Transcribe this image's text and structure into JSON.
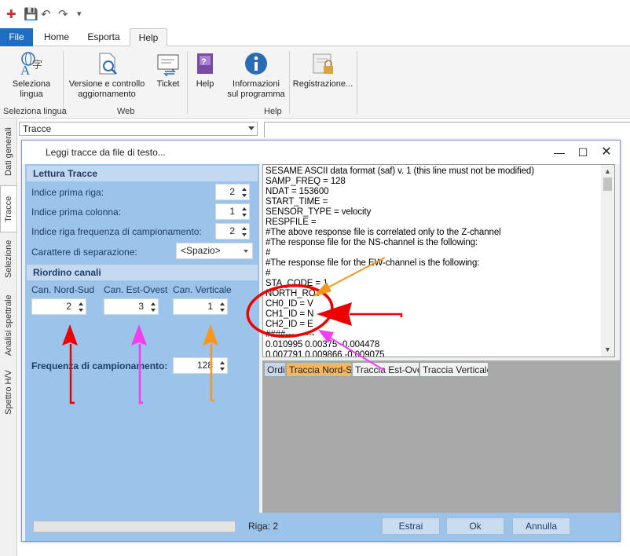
{
  "ribbon_tabs": {
    "file": "File",
    "home": "Home",
    "esporta": "Esporta",
    "help": "Help"
  },
  "ribbon": {
    "seleziona_lingua_line1": "Seleziona",
    "seleziona_lingua_line2": "lingua",
    "versione_line1": "Versione e controllo",
    "versione_line2": "aggiornamento",
    "ticket": "Ticket",
    "help": "Help",
    "informazioni_line1": "Informazioni",
    "informazioni_line2": "sul programma",
    "registrazione": "Registrazione...",
    "group_seleziona_lingua": "Seleziona lingua",
    "group_web": "Web",
    "group_help": "Help"
  },
  "side_tabs": [
    "Dati generali",
    "Tracce",
    "Selezione",
    "Analisi spettrale",
    "Spettro H/V"
  ],
  "tracce_combo": "Tracce",
  "dialog": {
    "title": "Leggi tracce da file di testo...",
    "lettura_header": "Lettura Tracce",
    "fields": [
      {
        "label": "Indice prima riga:",
        "value": "2"
      },
      {
        "label": "Indice prima colonna:",
        "value": "1"
      },
      {
        "label": "Indice riga frequenza di campionamento:",
        "value": "2"
      }
    ],
    "separator_label": "Carattere di separazione:",
    "separator_value": "<Spazio>",
    "riordino_header": "Riordino canali",
    "channels": [
      {
        "label": "Can. Nord-Sud",
        "value": "2"
      },
      {
        "label": "Can. Est-Ovest",
        "value": "3"
      },
      {
        "label": "Can. Verticale",
        "value": "1"
      }
    ],
    "freq_label": "Frequenza di campionamento:",
    "freq_value": "128",
    "file_lines": [
      "SESAME ASCII data format (saf) v. 1    (this line must not be modified)",
      "SAMP_FREQ = 128",
      "NDAT = 153600",
      "START_TIME =",
      "SENSOR_TYPE = velocity",
      "RESPFILE =",
      "#The above response file is correlated only to the Z-channel",
      "#The response file for the NS-channel is the following:",
      "#",
      "#The response file for the EW-channel is the following:",
      "#",
      "STA_CODE = 1",
      "NORTH_ROT",
      "CH0_ID = V",
      "CH1_ID = N",
      "CH2_ID = E",
      "####----------",
      "0.010995 0.00375 -0.004478",
      "0.007791 0.009866 -0.009075"
    ],
    "grid_tabs": [
      "Ordin",
      "Traccia Nord-Sud",
      "Traccia Est-Ovest",
      "Traccia Verticale"
    ],
    "riga": "Riga: 2",
    "buttons": {
      "estrai": "Estrai",
      "ok": "Ok",
      "annulla": "Annulla"
    }
  }
}
